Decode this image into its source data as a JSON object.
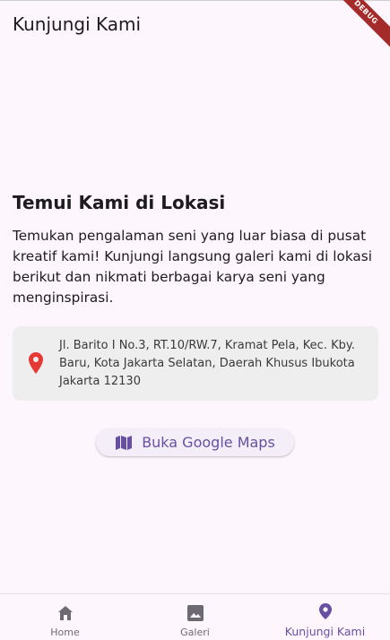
{
  "appbar": {
    "title": "Kunjungi Kami",
    "debug_label": "DEBUG"
  },
  "main": {
    "heading": "Temui Kami di Lokasi",
    "description": "Temukan pengalaman seni yang luar biasa di pusat kreatif kami! Kunjungi langsung galeri kami di lokasi berikut dan nikmati berbagai karya seni yang menginspirasi.",
    "address": "Jl. Barito I No.3, RT.10/RW.7, Kramat Pela, Kec. Kby. Baru, Kota Jakarta Selatan, Daerah Khusus Ibukota Jakarta 12130",
    "maps_button_label": "Buka Google Maps"
  },
  "bottom_nav": {
    "items": [
      {
        "label": "Home",
        "icon": "home-icon",
        "active": false
      },
      {
        "label": "Galeri",
        "icon": "image-icon",
        "active": false
      },
      {
        "label": "Kunjungi Kami",
        "icon": "location-pin-icon",
        "active": true
      }
    ]
  },
  "colors": {
    "accent": "#6750a4",
    "pin": "#e53935",
    "background": "#fdf7fd",
    "card": "#eeeeee",
    "debug_banner": "#a52a2a"
  }
}
